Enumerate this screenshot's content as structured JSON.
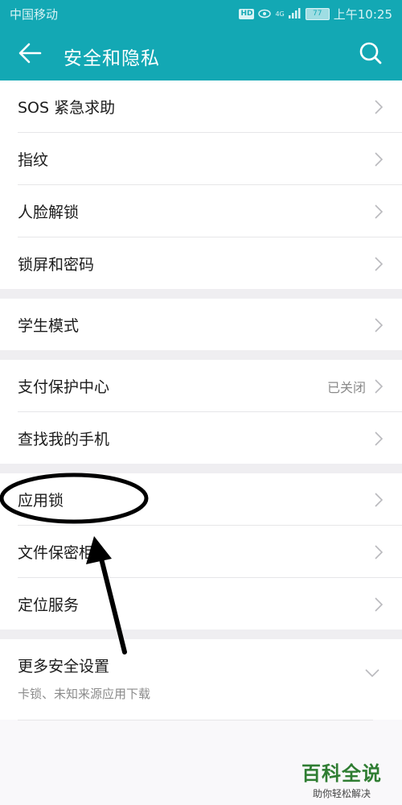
{
  "status": {
    "carrier": "中国移动",
    "hd": "HD",
    "network": "4G",
    "battery": "77",
    "time": "上午10:25"
  },
  "header": {
    "title": "安全和隐私"
  },
  "groups": [
    {
      "items": [
        {
          "label": "SOS 紧急求助"
        },
        {
          "label": "指纹"
        },
        {
          "label": "人脸解锁"
        },
        {
          "label": "锁屏和密码"
        }
      ]
    },
    {
      "items": [
        {
          "label": "学生模式"
        }
      ]
    },
    {
      "items": [
        {
          "label": "支付保护中心",
          "value": "已关闭"
        },
        {
          "label": "查找我的手机"
        }
      ]
    },
    {
      "items": [
        {
          "label": "应用锁"
        },
        {
          "label": "文件保密柜"
        },
        {
          "label": "定位服务"
        }
      ]
    },
    {
      "items": [
        {
          "label": "更多安全设置",
          "sublabel": "卡锁、未知来源应用下载"
        }
      ]
    }
  ],
  "watermark": {
    "main": "百科全说",
    "sub": "助你轻松解决"
  },
  "colors": {
    "accent": "#13a8b4",
    "background": "#f9f8fa"
  }
}
